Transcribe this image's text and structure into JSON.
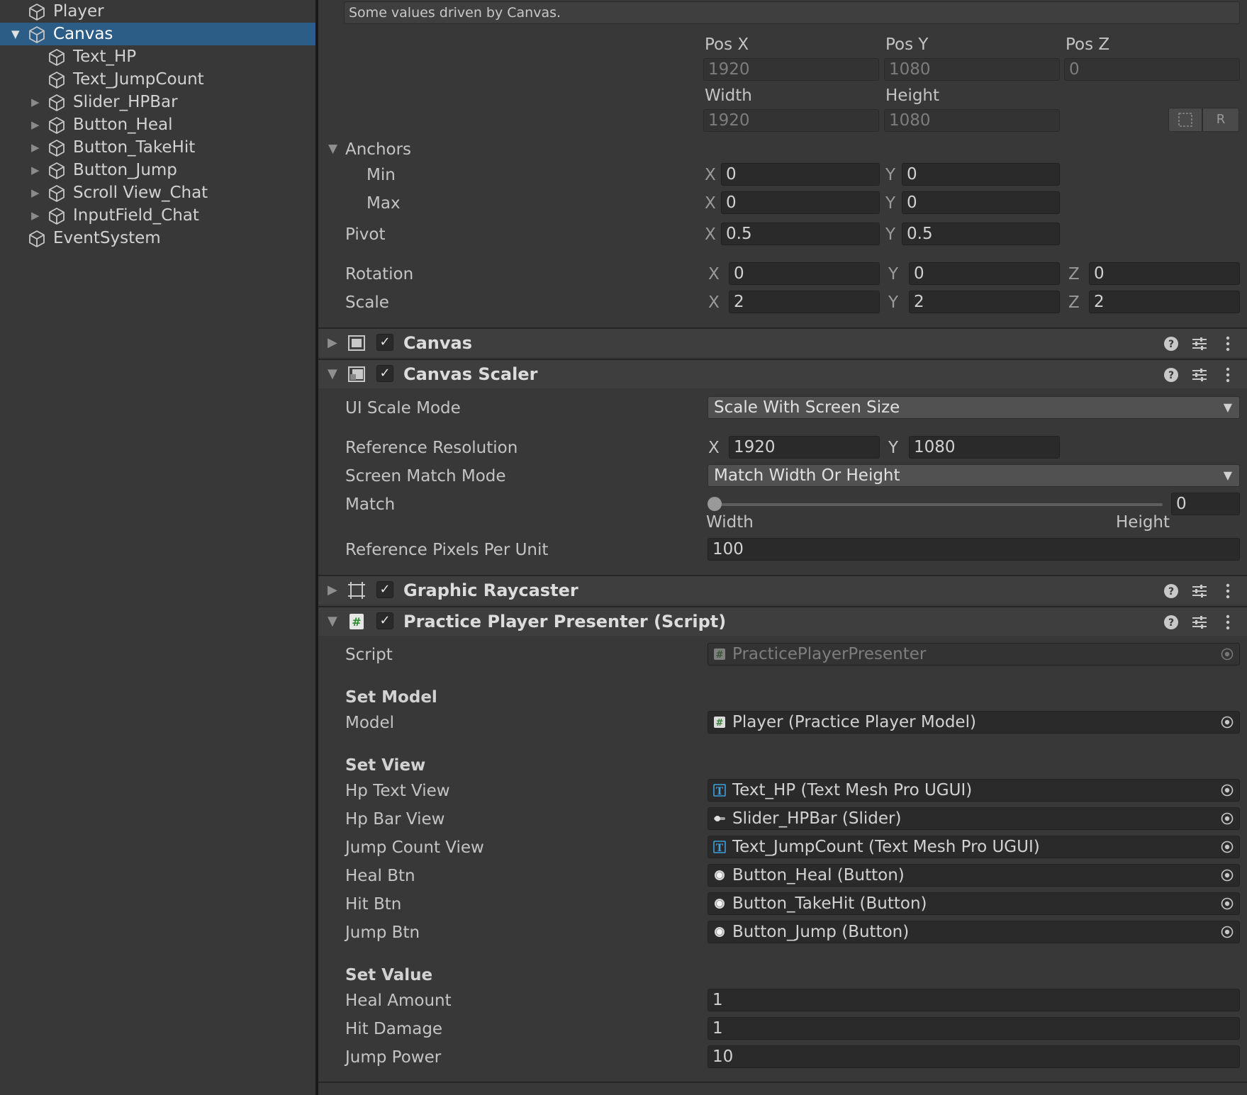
{
  "hierarchy": {
    "items": [
      {
        "label": "Player",
        "depth": 0,
        "expandable": false,
        "selected": false
      },
      {
        "label": "Canvas",
        "depth": 0,
        "expandable": true,
        "selected": true
      },
      {
        "label": "Text_HP",
        "depth": 1,
        "expandable": false,
        "selected": false
      },
      {
        "label": "Text_JumpCount",
        "depth": 1,
        "expandable": false,
        "selected": false
      },
      {
        "label": "Slider_HPBar",
        "depth": 1,
        "expandable": true,
        "selected": false
      },
      {
        "label": "Button_Heal",
        "depth": 1,
        "expandable": true,
        "selected": false
      },
      {
        "label": "Button_TakeHit",
        "depth": 1,
        "expandable": true,
        "selected": false
      },
      {
        "label": "Button_Jump",
        "depth": 1,
        "expandable": true,
        "selected": false
      },
      {
        "label": "Scroll View_Chat",
        "depth": 1,
        "expandable": true,
        "selected": false
      },
      {
        "label": "InputField_Chat",
        "depth": 1,
        "expandable": true,
        "selected": false
      },
      {
        "label": "EventSystem",
        "depth": 0,
        "expandable": false,
        "selected": false
      }
    ]
  },
  "rect_transform": {
    "driven_note": "Some values driven by Canvas.",
    "pos_x_label": "Pos X",
    "pos_y_label": "Pos Y",
    "pos_z_label": "Pos Z",
    "pos_x": "1920",
    "pos_y": "1080",
    "pos_z": "0",
    "width_label": "Width",
    "height_label": "Height",
    "width": "1920",
    "height": "1080",
    "raw_button": "R",
    "anchors_label": "Anchors",
    "min_label": "Min",
    "min_x": "0",
    "min_y": "0",
    "max_label": "Max",
    "max_x": "0",
    "max_y": "0",
    "pivot_label": "Pivot",
    "pivot_x": "0.5",
    "pivot_y": "0.5",
    "rotation_label": "Rotation",
    "rot_x": "0",
    "rot_y": "0",
    "rot_z": "0",
    "scale_label": "Scale",
    "scale_x": "2",
    "scale_y": "2",
    "scale_z": "2",
    "axis_x": "X",
    "axis_y": "Y",
    "axis_z": "Z"
  },
  "components": {
    "canvas": "Canvas",
    "canvas_scaler": "Canvas Scaler",
    "graphic_raycaster": "Graphic Raycaster",
    "presenter": "Practice Player Presenter (Script)"
  },
  "canvas_scaler": {
    "ui_scale_mode_label": "UI Scale Mode",
    "ui_scale_mode": "Scale With Screen Size",
    "ref_res_label": "Reference Resolution",
    "ref_x": "1920",
    "ref_y": "1080",
    "screen_match_label": "Screen Match Mode",
    "screen_match": "Match Width Or Height",
    "match_label": "Match",
    "match_value": "0",
    "match_fraction": 0,
    "match_left": "Width",
    "match_right": "Height",
    "ppu_label": "Reference Pixels Per Unit",
    "ppu": "100"
  },
  "presenter": {
    "script_label": "Script",
    "script_value": "PracticePlayerPresenter",
    "set_model": "Set Model",
    "model_label": "Model",
    "model_value": "Player (Practice Player Model)",
    "set_view": "Set View",
    "hp_text_label": "Hp Text View",
    "hp_text_value": "Text_HP (Text Mesh Pro UGUI)",
    "hp_bar_label": "Hp Bar View",
    "hp_bar_value": "Slider_HPBar (Slider)",
    "jump_count_label": "Jump Count View",
    "jump_count_value": "Text_JumpCount (Text Mesh Pro UGUI)",
    "heal_btn_label": "Heal Btn",
    "heal_btn_value": "Button_Heal (Button)",
    "hit_btn_label": "Hit Btn",
    "hit_btn_value": "Button_TakeHit (Button)",
    "jump_btn_label": "Jump Btn",
    "jump_btn_value": "Button_Jump (Button)",
    "set_value": "Set Value",
    "heal_amount_label": "Heal Amount",
    "heal_amount": "1",
    "hit_damage_label": "Hit Damage",
    "hit_damage": "1",
    "jump_power_label": "Jump Power",
    "jump_power": "10"
  }
}
